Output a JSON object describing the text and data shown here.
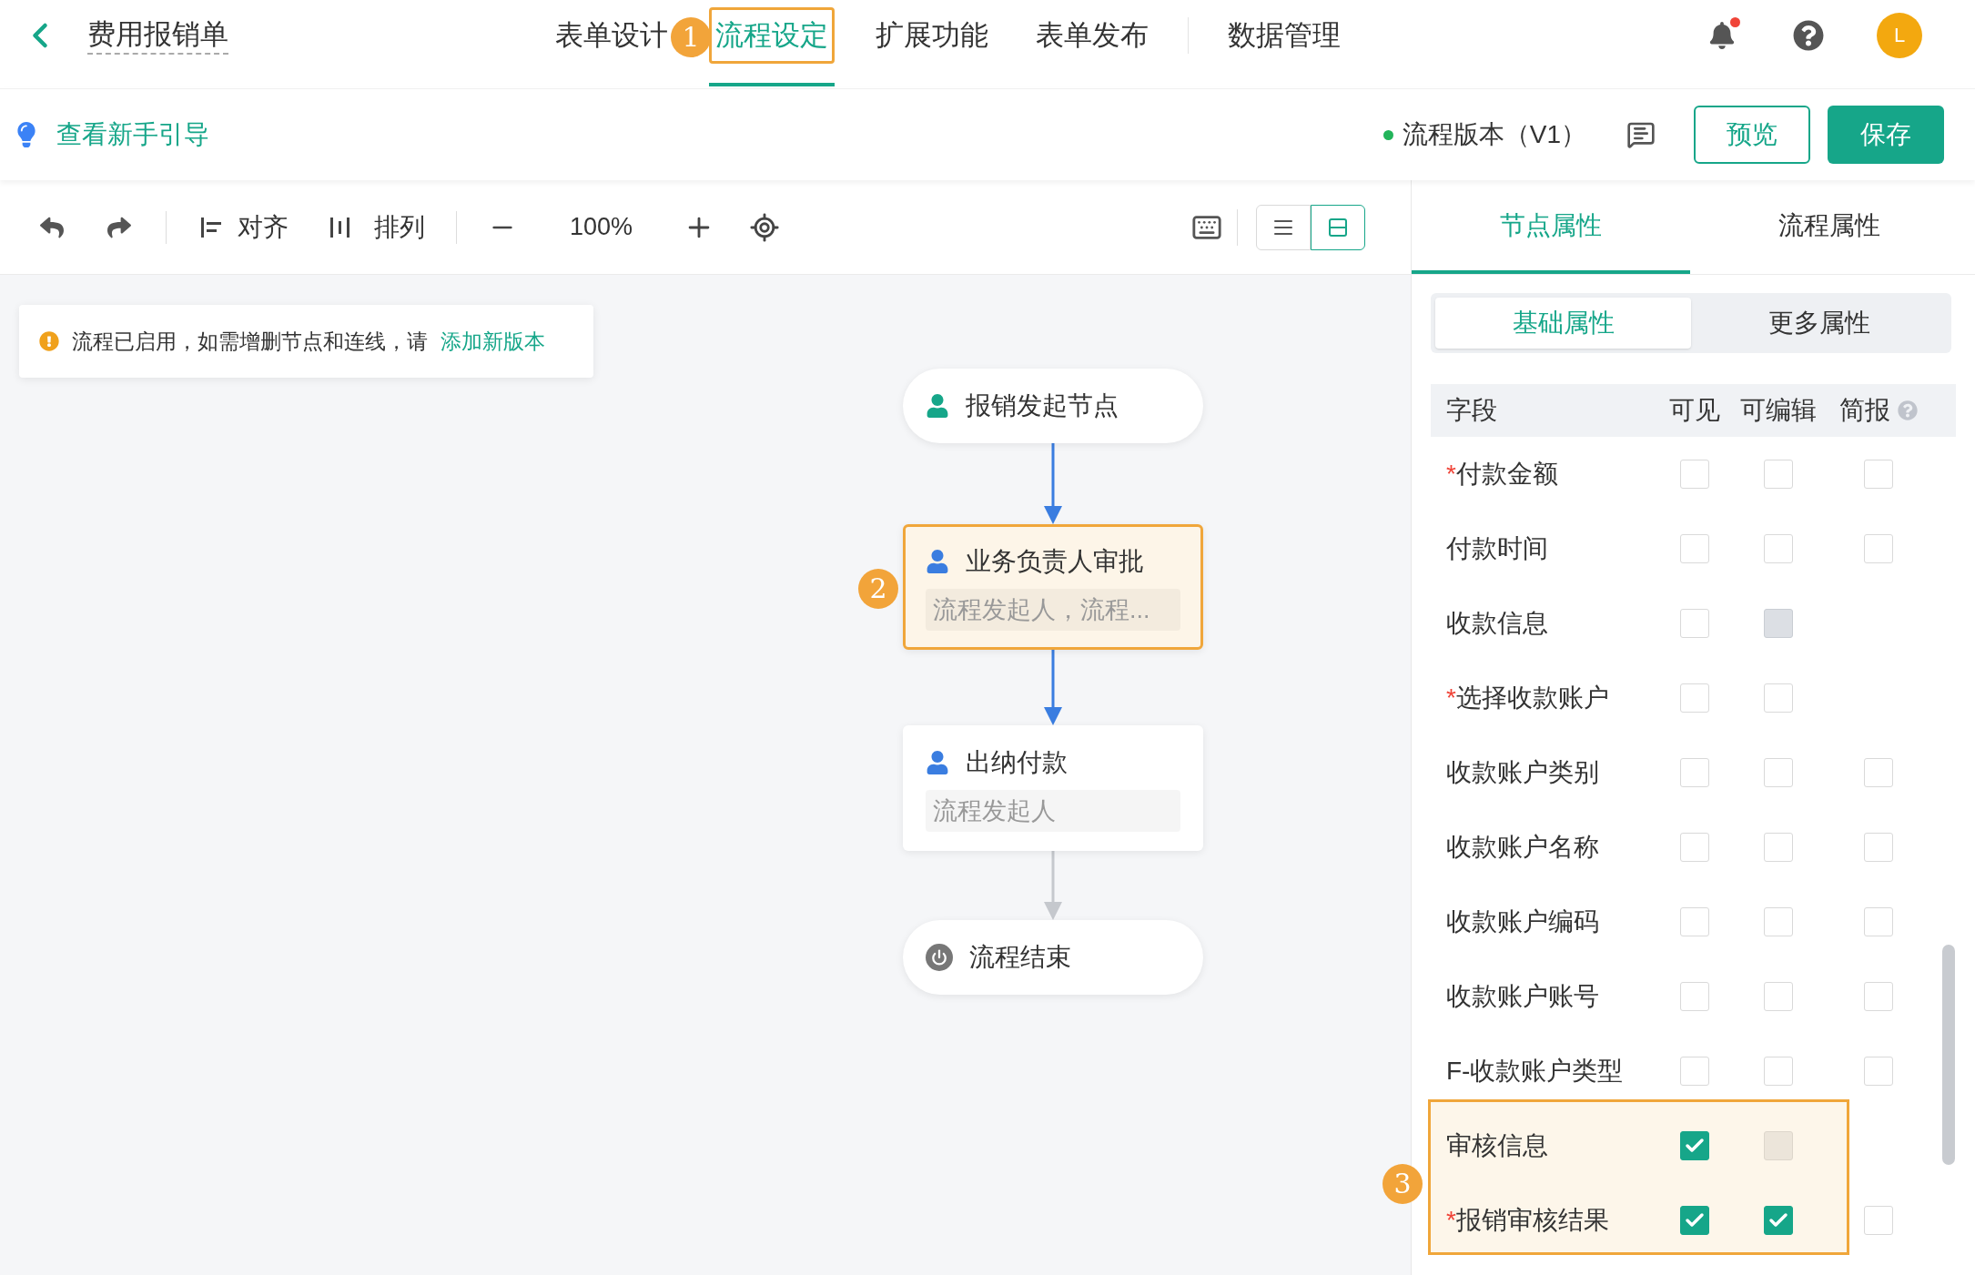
{
  "header": {
    "title": "费用报销单",
    "tabs": [
      {
        "label": "表单设计",
        "selected": false
      },
      {
        "label": "流程设定",
        "selected": true,
        "annotation": "1"
      },
      {
        "label": "扩展功能",
        "selected": false
      },
      {
        "label": "表单发布",
        "selected": false
      }
    ],
    "extra_tabs": [
      {
        "label": "数据管理",
        "selected": false
      }
    ],
    "notification": true,
    "avatar": "L"
  },
  "subbar": {
    "guide_link": "查看新手引导",
    "version": "流程版本（V1）",
    "buttons": [
      {
        "label": "预览",
        "kind": "outline"
      },
      {
        "label": "保存",
        "kind": "primary"
      }
    ]
  },
  "toolbar": {
    "align": "对齐",
    "arrange": "排列",
    "zoom": "100%",
    "view_modes": [
      {
        "selected": false
      },
      {
        "selected": true
      }
    ]
  },
  "notice": {
    "text": "流程已启用，如需增删节点和连线，请",
    "link": "添加新版本"
  },
  "nodes": [
    {
      "kind": "start",
      "title": "报销发起节点",
      "highlighted": false
    },
    {
      "kind": "approver",
      "title": "业务负责人审批",
      "assignee": "流程发起人，流程...",
      "highlighted": true,
      "annotation": "2"
    },
    {
      "kind": "approver",
      "title": "出纳付款",
      "assignee": "流程发起人",
      "highlighted": false
    },
    {
      "kind": "end",
      "title": "流程结束",
      "highlighted": false
    }
  ],
  "edges": [
    {
      "active": true
    },
    {
      "active": true
    },
    {
      "active": false
    }
  ],
  "panel": {
    "tabs": [
      {
        "label": "节点属性",
        "selected": true
      },
      {
        "label": "流程属性",
        "selected": false
      }
    ],
    "subtabs": [
      {
        "label": "基础属性",
        "selected": true
      },
      {
        "label": "更多属性",
        "selected": false
      }
    ],
    "columns": [
      "字段",
      "可见",
      "可编辑",
      "简报"
    ],
    "annotation": "3",
    "rows": [
      {
        "label": "*付款金额",
        "required": true,
        "highlighted": false,
        "visible": {
          "checked": false,
          "disabled": false
        },
        "editable": {
          "checked": false,
          "disabled": false
        },
        "brief": {
          "checked": false,
          "disabled": false
        }
      },
      {
        "label": "付款时间",
        "required": false,
        "highlighted": false,
        "visible": {
          "checked": false,
          "disabled": false
        },
        "editable": {
          "checked": false,
          "disabled": false
        },
        "brief": {
          "checked": false,
          "disabled": false
        }
      },
      {
        "label": "收款信息",
        "required": false,
        "highlighted": false,
        "visible": {
          "checked": false,
          "disabled": false
        },
        "editable": {
          "checked": false,
          "disabled": true
        }
      },
      {
        "label": "*选择收款账户",
        "required": true,
        "highlighted": false,
        "visible": {
          "checked": false,
          "disabled": false
        },
        "editable": {
          "checked": false,
          "disabled": false
        }
      },
      {
        "label": "收款账户类别",
        "required": false,
        "highlighted": false,
        "visible": {
          "checked": false,
          "disabled": false
        },
        "editable": {
          "checked": false,
          "disabled": false
        },
        "brief": {
          "checked": false,
          "disabled": false
        }
      },
      {
        "label": "收款账户名称",
        "required": false,
        "highlighted": false,
        "visible": {
          "checked": false,
          "disabled": false
        },
        "editable": {
          "checked": false,
          "disabled": false
        },
        "brief": {
          "checked": false,
          "disabled": false
        }
      },
      {
        "label": "收款账户编码",
        "required": false,
        "highlighted": false,
        "visible": {
          "checked": false,
          "disabled": false
        },
        "editable": {
          "checked": false,
          "disabled": false
        },
        "brief": {
          "checked": false,
          "disabled": false
        }
      },
      {
        "label": "收款账户账号",
        "required": false,
        "highlighted": false,
        "visible": {
          "checked": false,
          "disabled": false
        },
        "editable": {
          "checked": false,
          "disabled": false
        },
        "brief": {
          "checked": false,
          "disabled": false
        }
      },
      {
        "label": "F-收款账户类型",
        "required": false,
        "highlighted": false,
        "visible": {
          "checked": false,
          "disabled": false
        },
        "editable": {
          "checked": false,
          "disabled": false
        },
        "brief": {
          "checked": false,
          "disabled": false
        }
      },
      {
        "label": "审核信息",
        "required": false,
        "highlighted": true,
        "visible": {
          "checked": true,
          "disabled": false
        },
        "editable": {
          "checked": false,
          "disabled": true
        }
      },
      {
        "label": "*报销审核结果",
        "required": true,
        "highlighted": true,
        "visible": {
          "checked": true,
          "disabled": false
        },
        "editable": {
          "checked": true,
          "disabled": false
        },
        "brief": {
          "checked": false,
          "disabled": false
        }
      }
    ]
  }
}
